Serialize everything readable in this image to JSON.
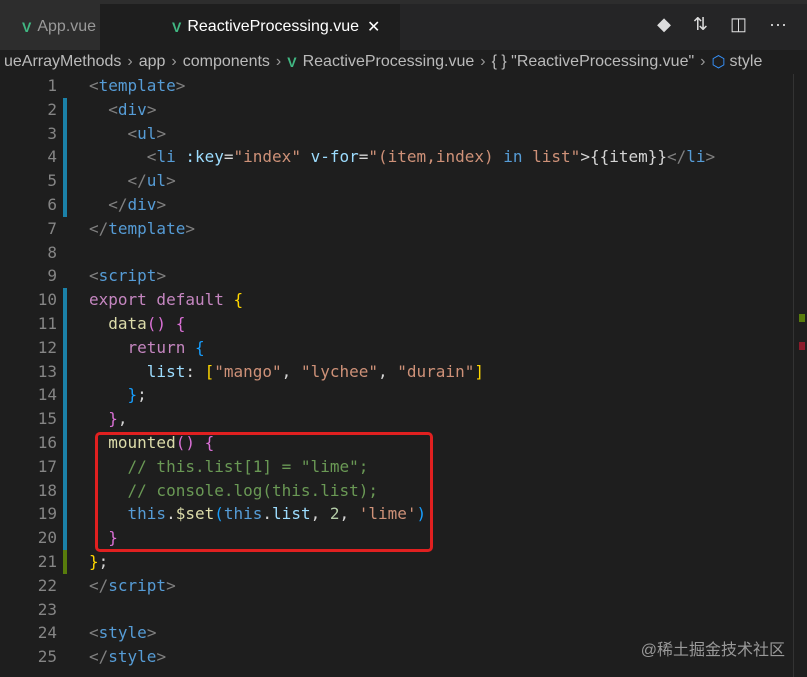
{
  "tabs": [
    {
      "label": "App.vue",
      "icon": "vue-icon"
    },
    {
      "label": "ReactiveProcessing.vue",
      "icon": "vue-icon",
      "close": "✕"
    }
  ],
  "actions": [
    "◆",
    "⇅",
    "◫",
    "···"
  ],
  "breadcrumb": [
    "ueArrayMethods",
    "app",
    "components",
    "ReactiveProcessing.vue",
    "{ }  \"ReactiveProcessing.vue\"",
    "style"
  ],
  "watermark": "@稀土掘金技术社区",
  "lines": [
    [
      [
        "<",
        "t"
      ],
      [
        "template",
        "tg"
      ],
      [
        ">",
        "t"
      ]
    ],
    [
      [
        "  ",
        ""
      ],
      [
        "<",
        "t"
      ],
      [
        "div",
        "tg"
      ],
      [
        ">",
        "t"
      ]
    ],
    [
      [
        "    ",
        ""
      ],
      [
        "<",
        "t"
      ],
      [
        "ul",
        "tg"
      ],
      [
        ">",
        "t"
      ]
    ],
    [
      [
        "      ",
        ""
      ],
      [
        "<",
        "t"
      ],
      [
        "li",
        "tg"
      ],
      [
        " :key",
        "at"
      ],
      [
        "=",
        "w"
      ],
      [
        "\"index\"",
        "s"
      ],
      [
        " v-for",
        "at"
      ],
      [
        "=",
        "w"
      ],
      [
        "\"(item,index) ",
        "s"
      ],
      [
        "in",
        "tg"
      ],
      [
        " list\"",
        "s"
      ],
      [
        ">{{item}}",
        "w"
      ],
      [
        "</",
        "t"
      ],
      [
        "li",
        "tg"
      ],
      [
        ">",
        "t"
      ]
    ],
    [
      [
        "    ",
        ""
      ],
      [
        "</",
        "t"
      ],
      [
        "ul",
        "tg"
      ],
      [
        ">",
        "t"
      ]
    ],
    [
      [
        "  ",
        ""
      ],
      [
        "</",
        "t"
      ],
      [
        "div",
        "tg"
      ],
      [
        ">",
        "t"
      ]
    ],
    [
      [
        "</",
        "t"
      ],
      [
        "template",
        "tg"
      ],
      [
        ">",
        "t"
      ]
    ],
    [],
    [
      [
        "<",
        "t"
      ],
      [
        "script",
        "tg"
      ],
      [
        ">",
        "t"
      ]
    ],
    [
      [
        "export default ",
        "kw"
      ],
      [
        "{",
        "y"
      ]
    ],
    [
      [
        "  ",
        ""
      ],
      [
        "data",
        "fn"
      ],
      [
        "()",
        "pk"
      ],
      [
        " {",
        "pk"
      ]
    ],
    [
      [
        "    ",
        ""
      ],
      [
        "return ",
        "kw"
      ],
      [
        "{",
        "bl"
      ]
    ],
    [
      [
        "      ",
        ""
      ],
      [
        "list",
        "v"
      ],
      [
        ": ",
        "w"
      ],
      [
        "[",
        "y"
      ],
      [
        "\"mango\"",
        "s"
      ],
      [
        ", ",
        "w"
      ],
      [
        "\"lychee\"",
        "s"
      ],
      [
        ", ",
        "w"
      ],
      [
        "\"durain\"",
        "s"
      ],
      [
        "]",
        "y"
      ]
    ],
    [
      [
        "    ",
        ""
      ],
      [
        "}",
        "bl"
      ],
      [
        ";",
        "w"
      ]
    ],
    [
      [
        "  ",
        ""
      ],
      [
        "}",
        "pk"
      ],
      [
        ",",
        "w"
      ]
    ],
    [
      [
        "  ",
        ""
      ],
      [
        "mounted",
        "fn"
      ],
      [
        "()",
        "pk"
      ],
      [
        " {",
        "pk"
      ]
    ],
    [
      [
        "    ",
        ""
      ],
      [
        "// this.list[1] = \"lime\";",
        "c"
      ]
    ],
    [
      [
        "    ",
        ""
      ],
      [
        "// console.log(this.list);",
        "c"
      ]
    ],
    [
      [
        "    ",
        ""
      ],
      [
        "this",
        "tg"
      ],
      [
        ".",
        "w"
      ],
      [
        "$set",
        "fn"
      ],
      [
        "(",
        "bl"
      ],
      [
        "this",
        "tg"
      ],
      [
        ".",
        "w"
      ],
      [
        "list",
        "v"
      ],
      [
        ", ",
        "w"
      ],
      [
        "2",
        "n"
      ],
      [
        ", ",
        "w"
      ],
      [
        "'lime'",
        "s"
      ],
      [
        ")",
        "bl"
      ]
    ],
    [
      [
        "  ",
        ""
      ],
      [
        "}",
        "pk"
      ]
    ],
    [
      [
        "}",
        "y"
      ],
      [
        ";",
        "w"
      ]
    ],
    [
      [
        "</",
        "t"
      ],
      [
        "script",
        "tg"
      ],
      [
        ">",
        "t"
      ]
    ],
    [],
    [
      [
        "<",
        "t"
      ],
      [
        "style",
        "tg"
      ],
      [
        ">",
        "t"
      ]
    ],
    [
      [
        "</",
        "t"
      ],
      [
        "style",
        "tg"
      ],
      [
        ">",
        "t"
      ]
    ]
  ]
}
